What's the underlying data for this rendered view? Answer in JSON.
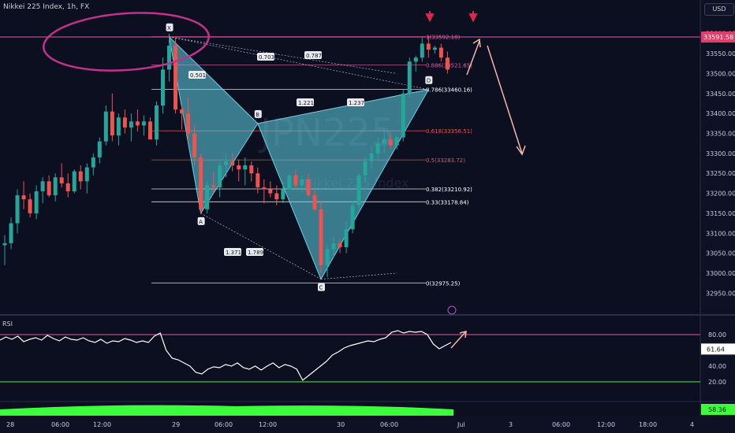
{
  "header": {
    "title": "Nikkei 225 Index, 1h, FX",
    "currency": "USD",
    "watermark": "JPN225",
    "watermark_sub": "Nikkei 225 Index"
  },
  "colors": {
    "up": "#26a69a",
    "down": "#ef5350",
    "pattern": "#5fd3e8",
    "level": "#e05ba0",
    "rsi": "#ffffff",
    "volume": "#3cff3c",
    "bg": "#0c0f20"
  },
  "price_axis": {
    "ticks": [
      33600.0,
      33550.0,
      33500.0,
      33450.0,
      33400.0,
      33350.0,
      33300.0,
      33250.0,
      33200.0,
      33150.0,
      33100.0,
      33050.0,
      33000.0,
      32950.0
    ],
    "current_price": "33591.58",
    "range": [
      32925,
      33635
    ]
  },
  "time_axis": [
    "28",
    "06:00",
    "12:00",
    "29",
    "06:00",
    "12:00",
    "30",
    "06:00",
    "Jul",
    "3",
    "06:00",
    "12:00",
    "18:00",
    "4"
  ],
  "chart_data": {
    "type": "candlestick",
    "candles": [
      {
        "o": 33070,
        "h": 33095,
        "l": 33020,
        "c": 33075
      },
      {
        "o": 33075,
        "h": 33140,
        "l": 33060,
        "c": 33125
      },
      {
        "o": 33125,
        "h": 33210,
        "l": 33100,
        "c": 33195
      },
      {
        "o": 33195,
        "h": 33230,
        "l": 33160,
        "c": 33185
      },
      {
        "o": 33185,
        "h": 33200,
        "l": 33140,
        "c": 33150
      },
      {
        "o": 33150,
        "h": 33220,
        "l": 33135,
        "c": 33205
      },
      {
        "o": 33205,
        "h": 33240,
        "l": 33175,
        "c": 33230
      },
      {
        "o": 33230,
        "h": 33245,
        "l": 33190,
        "c": 33195
      },
      {
        "o": 33195,
        "h": 33250,
        "l": 33180,
        "c": 33240
      },
      {
        "o": 33240,
        "h": 33275,
        "l": 33215,
        "c": 33225
      },
      {
        "o": 33225,
        "h": 33250,
        "l": 33190,
        "c": 33205
      },
      {
        "o": 33205,
        "h": 33260,
        "l": 33200,
        "c": 33255
      },
      {
        "o": 33255,
        "h": 33270,
        "l": 33210,
        "c": 33230
      },
      {
        "o": 33230,
        "h": 33275,
        "l": 33200,
        "c": 33265
      },
      {
        "o": 33265,
        "h": 33300,
        "l": 33245,
        "c": 33290
      },
      {
        "o": 33290,
        "h": 33340,
        "l": 33275,
        "c": 33330
      },
      {
        "o": 33330,
        "h": 33420,
        "l": 33320,
        "c": 33405
      },
      {
        "o": 33405,
        "h": 33450,
        "l": 33330,
        "c": 33345
      },
      {
        "o": 33345,
        "h": 33400,
        "l": 33320,
        "c": 33390
      },
      {
        "o": 33390,
        "h": 33410,
        "l": 33350,
        "c": 33365
      },
      {
        "o": 33365,
        "h": 33400,
        "l": 33330,
        "c": 33380
      },
      {
        "o": 33380,
        "h": 33410,
        "l": 33355,
        "c": 33370
      },
      {
        "o": 33370,
        "h": 33395,
        "l": 33345,
        "c": 33380
      },
      {
        "o": 33380,
        "h": 33390,
        "l": 33340,
        "c": 33335
      },
      {
        "o": 33335,
        "h": 33430,
        "l": 33320,
        "c": 33420
      },
      {
        "o": 33420,
        "h": 33540,
        "l": 33400,
        "c": 33510
      },
      {
        "o": 33510,
        "h": 33600,
        "l": 33480,
        "c": 33570
      },
      {
        "o": 33570,
        "h": 33590,
        "l": 33400,
        "c": 33410
      },
      {
        "o": 33410,
        "h": 33420,
        "l": 33360,
        "c": 33400
      },
      {
        "o": 33400,
        "h": 33440,
        "l": 33330,
        "c": 33350
      },
      {
        "o": 33350,
        "h": 33370,
        "l": 33270,
        "c": 33290
      },
      {
        "o": 33290,
        "h": 33300,
        "l": 33150,
        "c": 33160
      },
      {
        "o": 33160,
        "h": 33230,
        "l": 33150,
        "c": 33220
      },
      {
        "o": 33220,
        "h": 33255,
        "l": 33200,
        "c": 33215
      },
      {
        "o": 33215,
        "h": 33280,
        "l": 33190,
        "c": 33270
      },
      {
        "o": 33270,
        "h": 33300,
        "l": 33240,
        "c": 33280
      },
      {
        "o": 33280,
        "h": 33300,
        "l": 33255,
        "c": 33270
      },
      {
        "o": 33270,
        "h": 33285,
        "l": 33230,
        "c": 33260
      },
      {
        "o": 33260,
        "h": 33290,
        "l": 33220,
        "c": 33270
      },
      {
        "o": 33270,
        "h": 33280,
        "l": 33230,
        "c": 33250
      },
      {
        "o": 33250,
        "h": 33265,
        "l": 33200,
        "c": 33215
      },
      {
        "o": 33215,
        "h": 33235,
        "l": 33175,
        "c": 33210
      },
      {
        "o": 33210,
        "h": 33230,
        "l": 33190,
        "c": 33200
      },
      {
        "o": 33200,
        "h": 33220,
        "l": 33170,
        "c": 33185
      },
      {
        "o": 33185,
        "h": 33230,
        "l": 33175,
        "c": 33210
      },
      {
        "o": 33210,
        "h": 33250,
        "l": 33205,
        "c": 33245
      },
      {
        "o": 33245,
        "h": 33260,
        "l": 33210,
        "c": 33220
      },
      {
        "o": 33220,
        "h": 33245,
        "l": 33200,
        "c": 33235
      },
      {
        "o": 33235,
        "h": 33250,
        "l": 33190,
        "c": 33195
      },
      {
        "o": 33195,
        "h": 33215,
        "l": 33155,
        "c": 33160
      },
      {
        "o": 33160,
        "h": 33180,
        "l": 33000,
        "c": 33020
      },
      {
        "o": 33020,
        "h": 33070,
        "l": 32990,
        "c": 33060
      },
      {
        "o": 33060,
        "h": 33090,
        "l": 33040,
        "c": 33075
      },
      {
        "o": 33075,
        "h": 33085,
        "l": 33050,
        "c": 33065
      },
      {
        "o": 33065,
        "h": 33130,
        "l": 33050,
        "c": 33110
      },
      {
        "o": 33110,
        "h": 33180,
        "l": 33100,
        "c": 33170
      },
      {
        "o": 33170,
        "h": 33250,
        "l": 33160,
        "c": 33245
      },
      {
        "o": 33245,
        "h": 33290,
        "l": 33230,
        "c": 33280
      },
      {
        "o": 33280,
        "h": 33320,
        "l": 33260,
        "c": 33300
      },
      {
        "o": 33300,
        "h": 33340,
        "l": 33280,
        "c": 33325
      },
      {
        "o": 33325,
        "h": 33360,
        "l": 33300,
        "c": 33335
      },
      {
        "o": 33335,
        "h": 33350,
        "l": 33310,
        "c": 33320
      },
      {
        "o": 33320,
        "h": 33345,
        "l": 33310,
        "c": 33340
      },
      {
        "o": 33340,
        "h": 33460,
        "l": 33330,
        "c": 33450
      },
      {
        "o": 33450,
        "h": 33540,
        "l": 33440,
        "c": 33530
      },
      {
        "o": 33530,
        "h": 33545,
        "l": 33505,
        "c": 33540
      },
      {
        "o": 33540,
        "h": 33590,
        "l": 33530,
        "c": 33575
      },
      {
        "o": 33575,
        "h": 33595,
        "l": 33540,
        "c": 33560
      },
      {
        "o": 33560,
        "h": 33570,
        "l": 33550,
        "c": 33565
      },
      {
        "o": 33565,
        "h": 33575,
        "l": 33530,
        "c": 33540
      },
      {
        "o": 33540,
        "h": 33555,
        "l": 33500,
        "c": 33510
      }
    ],
    "fib_levels": [
      {
        "label": "1(33592.18)",
        "value": 33592.18,
        "color": "#e05ba0"
      },
      {
        "label": "0.886(33521.65)",
        "value": 33521.65,
        "color": "#e05ba0"
      },
      {
        "label": "0.786(33460.16)",
        "value": 33460.16,
        "color": "#ffffff"
      },
      {
        "label": "0.618(33356.51)",
        "value": 33356.51,
        "color": "#ef5350"
      },
      {
        "label": "0.5(33283.72)",
        "value": 33283.72,
        "color": "#ef5350"
      },
      {
        "label": "0.382(33210.92)",
        "value": 33210.92,
        "color": "#ffffff"
      },
      {
        "label": "0.33(33178.84)",
        "value": 33178.84,
        "color": "#ffffff"
      },
      {
        "label": "0(32975.25)",
        "value": 32975.25,
        "color": "#ffffff"
      }
    ],
    "pattern_points": [
      {
        "label": "X",
        "i": 26,
        "price": 33592
      },
      {
        "label": "A",
        "i": 31,
        "price": 33150
      },
      {
        "label": "B",
        "i": 40,
        "price": 33375
      },
      {
        "label": "C",
        "i": 50,
        "price": 32985
      },
      {
        "label": "D",
        "i": 67,
        "price": 33460
      }
    ],
    "ratios": [
      "0.703",
      "0.787",
      "0.501",
      "1.221",
      "1.237",
      "1.371",
      "1.789"
    ],
    "rsi": {
      "label": "RSI",
      "current": "61.64",
      "levels": [
        80,
        20
      ],
      "ticks": [
        "80.00",
        "40.00",
        "20.00"
      ],
      "values": [
        73,
        77,
        74,
        78,
        71,
        74,
        76,
        73,
        79,
        75,
        72,
        77,
        74,
        73,
        76,
        72,
        70,
        74,
        69,
        72,
        71,
        75,
        73,
        70,
        72,
        70,
        78,
        82,
        60,
        50,
        48,
        44,
        40,
        32,
        30,
        36,
        39,
        38,
        42,
        40,
        44,
        38,
        36,
        40,
        35,
        40,
        44,
        38,
        42,
        40,
        36,
        22,
        28,
        34,
        40,
        46,
        54,
        58,
        63,
        66,
        68,
        70,
        72,
        71,
        74,
        76,
        83,
        85,
        82,
        84,
        83,
        84,
        80,
        68,
        62,
        66,
        70
      ]
    },
    "volume_label": "58.36"
  }
}
